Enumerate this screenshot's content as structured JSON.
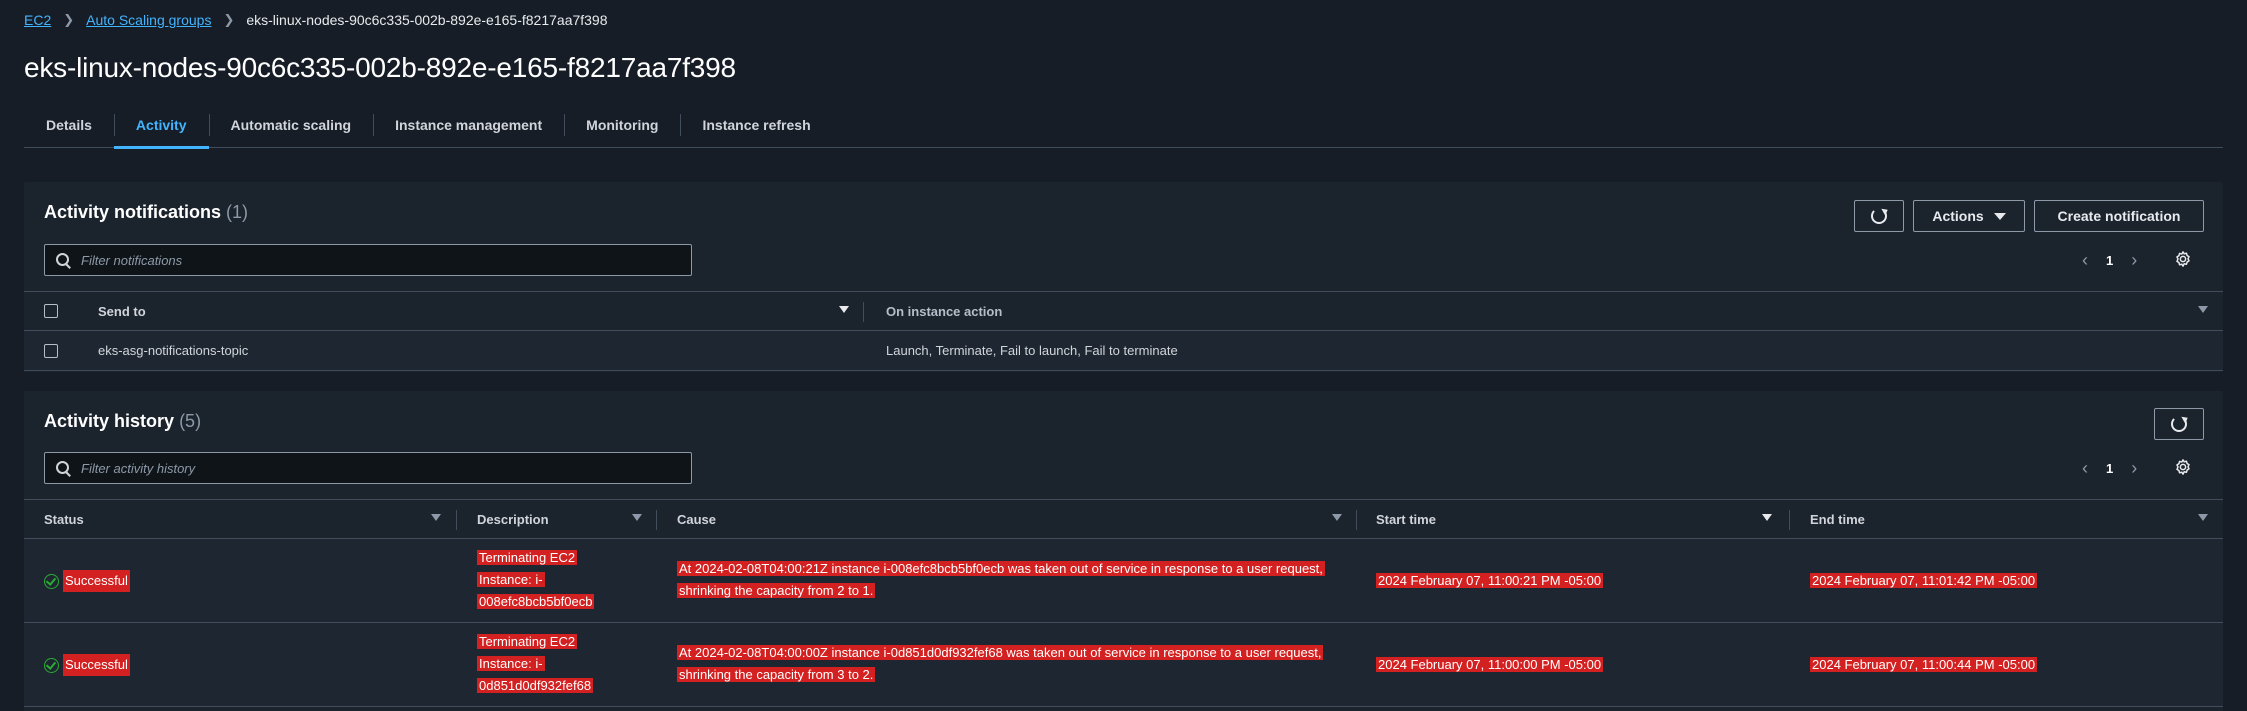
{
  "breadcrumb": {
    "items": [
      "EC2",
      "Auto Scaling groups"
    ],
    "current": "eks-linux-nodes-90c6c335-002b-892e-e165-f8217aa7f398"
  },
  "page_title": "eks-linux-nodes-90c6c335-002b-892e-e165-f8217aa7f398",
  "tabs": [
    {
      "label": "Details",
      "active": false
    },
    {
      "label": "Activity",
      "active": true
    },
    {
      "label": "Automatic scaling",
      "active": false
    },
    {
      "label": "Instance management",
      "active": false
    },
    {
      "label": "Monitoring",
      "active": false
    },
    {
      "label": "Instance refresh",
      "active": false
    }
  ],
  "notifications": {
    "title": "Activity notifications",
    "count": "(1)",
    "actions_label": "Actions",
    "create_label": "Create notification",
    "filter_placeholder": "Filter notifications",
    "page": "1",
    "columns": [
      "Send to",
      "On instance action"
    ],
    "rows": [
      {
        "send_to": "eks-asg-notifications-topic",
        "action": "Launch, Terminate, Fail to launch, Fail to terminate"
      }
    ]
  },
  "history": {
    "title": "Activity history",
    "count": "(5)",
    "filter_placeholder": "Filter activity history",
    "page": "1",
    "columns": [
      "Status",
      "Description",
      "Cause",
      "Start time",
      "End time"
    ],
    "rows": [
      {
        "status": "Successful",
        "description": "Terminating EC2 Instance: i-008efc8bcb5bf0ecb",
        "cause": "At 2024-02-08T04:00:21Z instance i-008efc8bcb5bf0ecb was taken out of service in response to a user request, shrinking the capacity from 2 to 1.",
        "start": "2024 February 07, 11:00:21 PM -05:00",
        "end": "2024 February 07, 11:01:42 PM -05:00"
      },
      {
        "status": "Successful",
        "description": "Terminating EC2 Instance: i-0d851d0df932fef68",
        "cause": "At 2024-02-08T04:00:00Z instance i-0d851d0df932fef68 was taken out of service in response to a user request, shrinking the capacity from 3 to 2.",
        "start": "2024 February 07, 11:00:00 PM -05:00",
        "end": "2024 February 07, 11:00:44 PM -05:00"
      }
    ]
  },
  "colors": {
    "background": "#161d26",
    "panel": "#1b232d",
    "accent": "#42b4ff",
    "success": "#29ad32",
    "redaction": "#d32020"
  }
}
